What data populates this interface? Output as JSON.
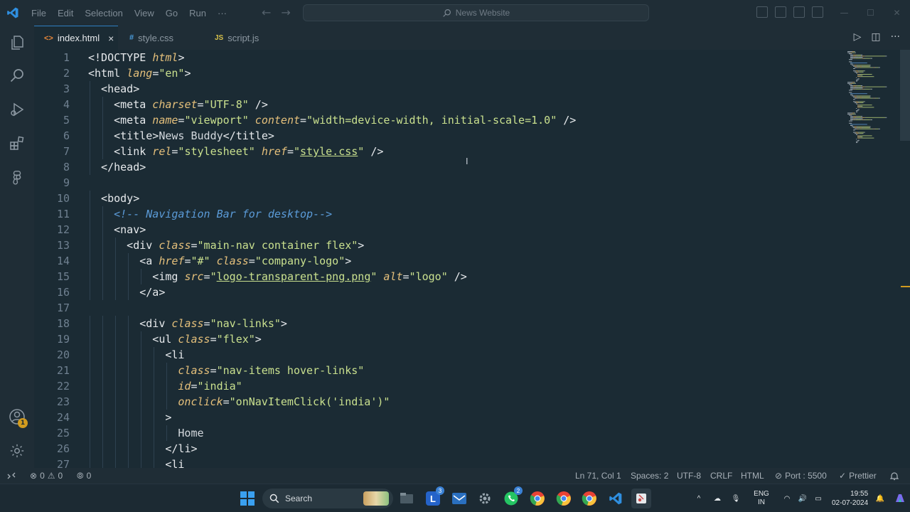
{
  "titlebar": {
    "menu": [
      "File",
      "Edit",
      "Selection",
      "View",
      "Go",
      "Run",
      "···"
    ],
    "search_text": "News Website"
  },
  "tabs": [
    {
      "icon": "<>",
      "label": "index.html",
      "active": true,
      "close": "×"
    },
    {
      "icon": "#",
      "label": "style.css",
      "active": false
    },
    {
      "icon": "JS",
      "label": "script.js",
      "active": false
    }
  ],
  "activity_badge": "1",
  "editor": {
    "lines": [
      {
        "n": "1",
        "indent": 0,
        "tokens": [
          {
            "t": "tag",
            "v": "<!DOCTYPE "
          },
          {
            "t": "attr",
            "v": "html"
          },
          {
            "t": "tag",
            "v": ">"
          }
        ]
      },
      {
        "n": "2",
        "indent": 0,
        "tokens": [
          {
            "t": "tag",
            "v": "<html "
          },
          {
            "t": "attr",
            "v": "lang"
          },
          {
            "t": "tag",
            "v": "="
          },
          {
            "t": "str",
            "v": "\"en\""
          },
          {
            "t": "tag",
            "v": ">"
          }
        ]
      },
      {
        "n": "3",
        "indent": 1,
        "tokens": [
          {
            "t": "tag",
            "v": "<head>"
          }
        ]
      },
      {
        "n": "4",
        "indent": 2,
        "tokens": [
          {
            "t": "tag",
            "v": "<meta "
          },
          {
            "t": "attr",
            "v": "charset"
          },
          {
            "t": "tag",
            "v": "="
          },
          {
            "t": "str",
            "v": "\"UTF-8\""
          },
          {
            "t": "tag",
            "v": " />"
          }
        ]
      },
      {
        "n": "5",
        "indent": 2,
        "tokens": [
          {
            "t": "tag",
            "v": "<meta "
          },
          {
            "t": "attr",
            "v": "name"
          },
          {
            "t": "tag",
            "v": "="
          },
          {
            "t": "str",
            "v": "\"viewport\""
          },
          {
            "t": "tag",
            "v": " "
          },
          {
            "t": "attr",
            "v": "content"
          },
          {
            "t": "tag",
            "v": "="
          },
          {
            "t": "str",
            "v": "\"width=device-width, initial-scale=1.0\""
          },
          {
            "t": "tag",
            "v": " />"
          }
        ]
      },
      {
        "n": "6",
        "indent": 2,
        "tokens": [
          {
            "t": "tag",
            "v": "<title>"
          },
          {
            "t": "plain",
            "v": "News Buddy"
          },
          {
            "t": "tag",
            "v": "</title>"
          }
        ]
      },
      {
        "n": "7",
        "indent": 2,
        "tokens": [
          {
            "t": "tag",
            "v": "<link "
          },
          {
            "t": "attr",
            "v": "rel"
          },
          {
            "t": "tag",
            "v": "="
          },
          {
            "t": "str",
            "v": "\"stylesheet\""
          },
          {
            "t": "tag",
            "v": " "
          },
          {
            "t": "attr",
            "v": "href"
          },
          {
            "t": "tag",
            "v": "="
          },
          {
            "t": "str",
            "v": "\""
          },
          {
            "t": "stru",
            "v": "style.css"
          },
          {
            "t": "str",
            "v": "\""
          },
          {
            "t": "tag",
            "v": " />"
          }
        ]
      },
      {
        "n": "8",
        "indent": 1,
        "tokens": [
          {
            "t": "tag",
            "v": "</head>"
          }
        ]
      },
      {
        "n": "9",
        "indent": 0,
        "tokens": []
      },
      {
        "n": "10",
        "indent": 1,
        "tokens": [
          {
            "t": "tag",
            "v": "<body>"
          }
        ]
      },
      {
        "n": "11",
        "indent": 2,
        "tokens": [
          {
            "t": "cmt",
            "v": "<!-- Navigation Bar for desktop-->"
          }
        ]
      },
      {
        "n": "12",
        "indent": 2,
        "tokens": [
          {
            "t": "tag",
            "v": "<nav>"
          }
        ]
      },
      {
        "n": "13",
        "indent": 3,
        "tokens": [
          {
            "t": "tag",
            "v": "<div "
          },
          {
            "t": "attr",
            "v": "class"
          },
          {
            "t": "tag",
            "v": "="
          },
          {
            "t": "str",
            "v": "\"main-nav container flex\""
          },
          {
            "t": "tag",
            "v": ">"
          }
        ]
      },
      {
        "n": "14",
        "indent": 4,
        "tokens": [
          {
            "t": "tag",
            "v": "<a "
          },
          {
            "t": "attr",
            "v": "href"
          },
          {
            "t": "tag",
            "v": "="
          },
          {
            "t": "str",
            "v": "\"#\""
          },
          {
            "t": "tag",
            "v": " "
          },
          {
            "t": "attr",
            "v": "class"
          },
          {
            "t": "tag",
            "v": "="
          },
          {
            "t": "str",
            "v": "\"company-logo\""
          },
          {
            "t": "tag",
            "v": ">"
          }
        ]
      },
      {
        "n": "15",
        "indent": 5,
        "tokens": [
          {
            "t": "tag",
            "v": "<img "
          },
          {
            "t": "attr",
            "v": "src"
          },
          {
            "t": "tag",
            "v": "="
          },
          {
            "t": "str",
            "v": "\""
          },
          {
            "t": "stru",
            "v": "logo-transparent-png.png"
          },
          {
            "t": "str",
            "v": "\""
          },
          {
            "t": "tag",
            "v": " "
          },
          {
            "t": "attr",
            "v": "alt"
          },
          {
            "t": "tag",
            "v": "="
          },
          {
            "t": "str",
            "v": "\"logo\""
          },
          {
            "t": "tag",
            "v": " />"
          }
        ]
      },
      {
        "n": "16",
        "indent": 4,
        "tokens": [
          {
            "t": "tag",
            "v": "</a>"
          }
        ]
      },
      {
        "n": "17",
        "indent": 0,
        "tokens": []
      },
      {
        "n": "18",
        "indent": 4,
        "tokens": [
          {
            "t": "tag",
            "v": "<div "
          },
          {
            "t": "attr",
            "v": "class"
          },
          {
            "t": "tag",
            "v": "="
          },
          {
            "t": "str",
            "v": "\"nav-links\""
          },
          {
            "t": "tag",
            "v": ">"
          }
        ]
      },
      {
        "n": "19",
        "indent": 5,
        "tokens": [
          {
            "t": "tag",
            "v": "<ul "
          },
          {
            "t": "attr",
            "v": "class"
          },
          {
            "t": "tag",
            "v": "="
          },
          {
            "t": "str",
            "v": "\"flex\""
          },
          {
            "t": "tag",
            "v": ">"
          }
        ]
      },
      {
        "n": "20",
        "indent": 6,
        "tokens": [
          {
            "t": "tag",
            "v": "<li"
          }
        ]
      },
      {
        "n": "21",
        "indent": 7,
        "tokens": [
          {
            "t": "attr",
            "v": "class"
          },
          {
            "t": "tag",
            "v": "="
          },
          {
            "t": "str",
            "v": "\"nav-items hover-links\""
          }
        ]
      },
      {
        "n": "22",
        "indent": 7,
        "tokens": [
          {
            "t": "attr",
            "v": "id"
          },
          {
            "t": "tag",
            "v": "="
          },
          {
            "t": "str",
            "v": "\"india\""
          }
        ]
      },
      {
        "n": "23",
        "indent": 7,
        "tokens": [
          {
            "t": "attr",
            "v": "onclick"
          },
          {
            "t": "tag",
            "v": "="
          },
          {
            "t": "str",
            "v": "\"onNavItemClick('india')\""
          }
        ]
      },
      {
        "n": "24",
        "indent": 6,
        "tokens": [
          {
            "t": "tag",
            "v": ">"
          }
        ]
      },
      {
        "n": "25",
        "indent": 7,
        "tokens": [
          {
            "t": "plain",
            "v": "Home"
          }
        ]
      },
      {
        "n": "26",
        "indent": 6,
        "tokens": [
          {
            "t": "tag",
            "v": "</li>"
          }
        ]
      },
      {
        "n": "27",
        "indent": 6,
        "tokens": [
          {
            "t": "tag",
            "v": "<li"
          }
        ]
      }
    ]
  },
  "statusbar": {
    "errors": "0",
    "warnings": "0",
    "ports": "0",
    "position": "Ln 71, Col 1",
    "spaces": "Spaces: 2",
    "encoding": "UTF-8",
    "eol": "CRLF",
    "language": "HTML",
    "port": "Port : 5500",
    "prettier": "Prettier"
  },
  "taskbar": {
    "search_label": "Search",
    "lang_line1": "ENG",
    "lang_line2": "IN",
    "time": "19:55",
    "date": "02-07-2024",
    "badge_l": "3",
    "badge_wa": "2"
  },
  "colors": {
    "background": "#1b2b34",
    "accent": "#2f7fc1",
    "warning": "#d29b1f"
  }
}
